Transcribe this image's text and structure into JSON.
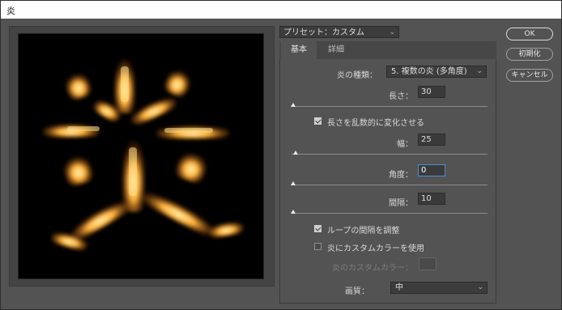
{
  "window": {
    "title": "炎"
  },
  "preview": {
    "description_icon": "flame-text-preview"
  },
  "preset": {
    "label": "プリセット：カスタム"
  },
  "tabs": [
    {
      "label": "基本"
    },
    {
      "label": "詳細"
    }
  ],
  "fields": {
    "flame_type": {
      "label": "炎の種類：",
      "value": "5. 複数の炎 (多角度)"
    },
    "length": {
      "label": "長さ：",
      "value": "30",
      "slider_fraction": 0.0
    },
    "randomize_length": {
      "label": "長さを乱数的に変化させる",
      "checked": true
    },
    "width": {
      "label": "幅：",
      "value": "25",
      "slider_fraction": 0.03
    },
    "angle": {
      "label": "角度：",
      "value": "0",
      "slider_fraction": 0.0
    },
    "interval": {
      "label": "間隔：",
      "value": "10",
      "slider_fraction": 0.0
    },
    "adjust_loop": {
      "label": "ループの間隔を調整",
      "checked": true
    },
    "custom_color": {
      "label": "炎にカスタムカラーを使用",
      "checked": false
    },
    "flame_custom_color": {
      "label": "炎のカスタムカラー："
    },
    "quality": {
      "label": "画質：",
      "value": "中"
    }
  },
  "buttons": {
    "ok": "OK",
    "reset": "初期化",
    "cancel": "キャンセル"
  },
  "colors": {
    "background": "#535353",
    "flame": "#ffb23a"
  }
}
